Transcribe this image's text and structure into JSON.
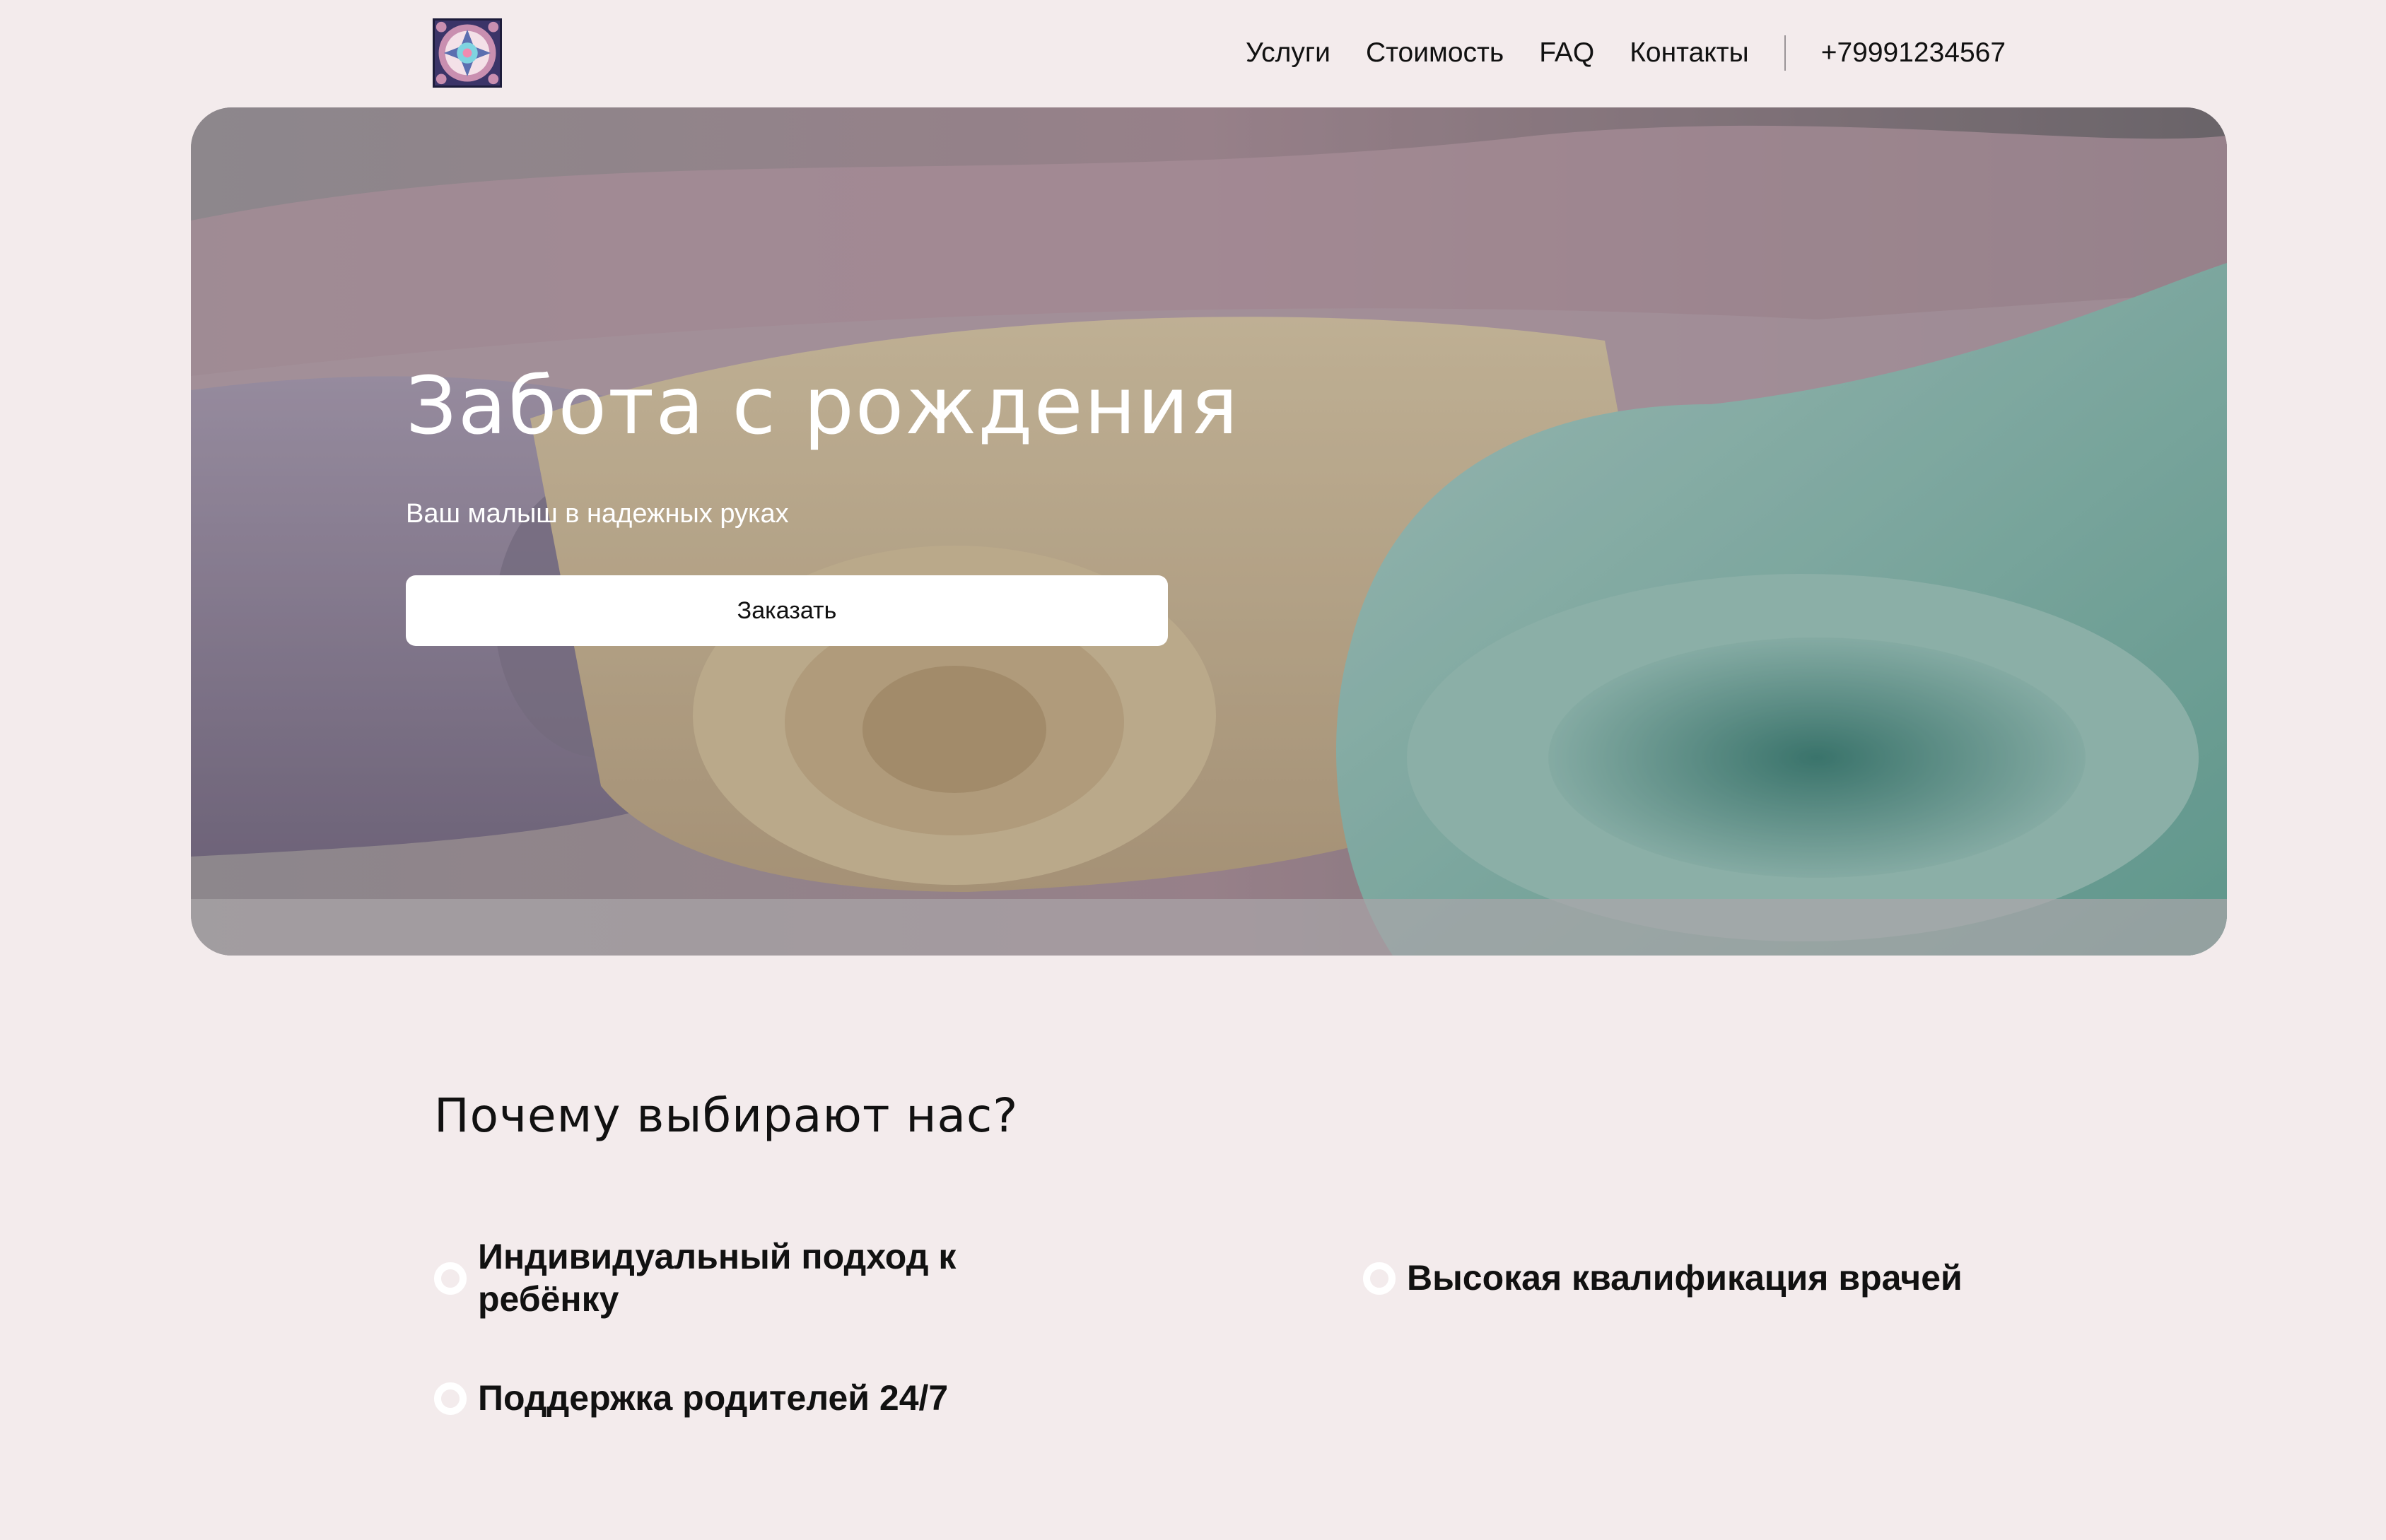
{
  "header": {
    "logo_icon": "mandala-logo-icon",
    "nav": [
      "Услуги",
      "Стоимость",
      "FAQ",
      "Контакты"
    ],
    "phone": "+79991234567"
  },
  "hero": {
    "title": "Забота с рождения",
    "subtitle": "Ваш малыш в надежных руках",
    "cta_label": "Заказать",
    "background": "folded-baby-blankets-photo"
  },
  "why": {
    "title": "Почему выбирают нас?",
    "features": [
      "Индивидуальный подход к ребёнку",
      "Высокая квалификация врачей",
      "Поддержка родителей 24/7"
    ]
  },
  "colors": {
    "page_background": "#f3ebec",
    "button_background": "#ffffff",
    "text": "#111111"
  }
}
